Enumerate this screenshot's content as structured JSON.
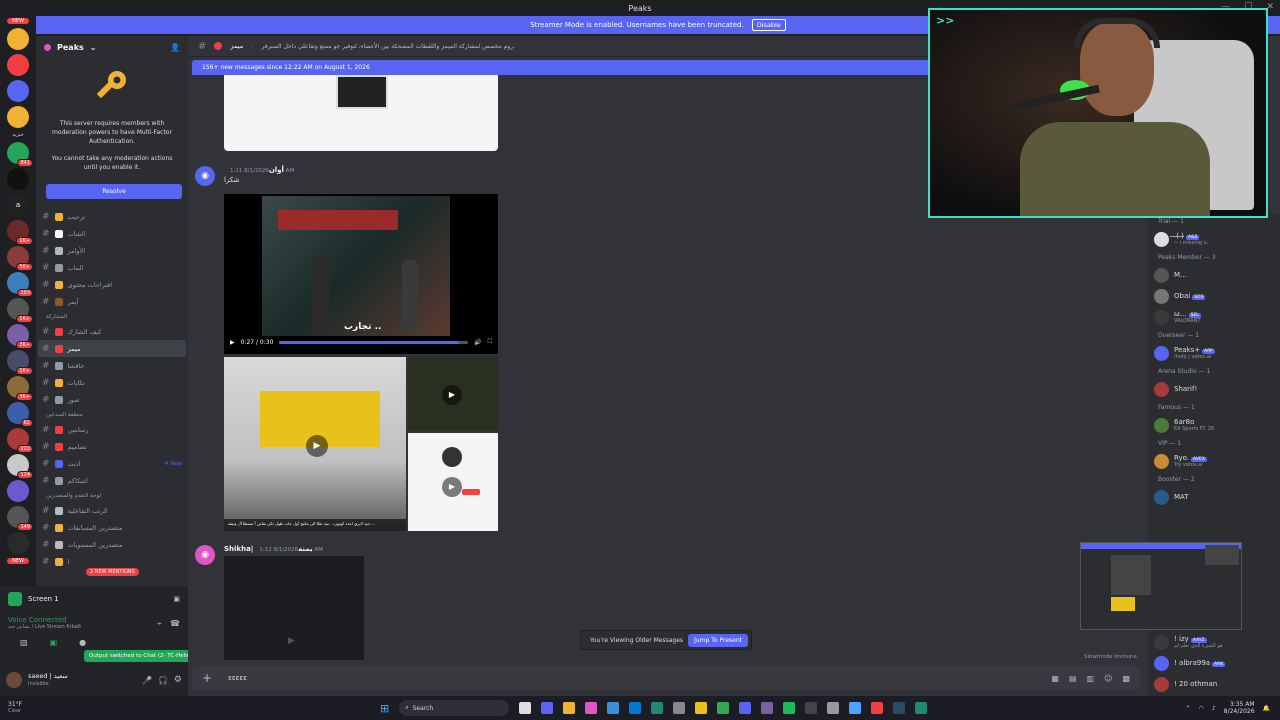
{
  "window": {
    "title": "Peaks"
  },
  "banner": {
    "text": "Streamer Mode is enabled. Usernames have been truncated.",
    "button": "Disable"
  },
  "servers": {
    "top_badge": "NEW",
    "bottom_badge": "NEW",
    "badges": [
      "841",
      "1K+",
      "5K+",
      "103",
      "1K+",
      "3K+",
      "1K+",
      "3K+",
      "62",
      "222",
      "124",
      "149"
    ],
    "labels": [
      "خنزيد",
      "a"
    ]
  },
  "sidebar": {
    "server_name": "Peaks",
    "mfa_notice": "This server requires members with moderation powers to have Multi-Factor Authentication.",
    "mfa_notice2": "You cannot take any moderation actions until you enable it.",
    "resolve": "Resolve",
    "channels_top": [
      {
        "name": "ترحيب",
        "color": "#f0b232"
      },
      {
        "name": "الشات",
        "color": "#ffffff"
      },
      {
        "name": "الأوامر",
        "color": "#b5bac1"
      },
      {
        "name": "الماب",
        "color": "#949ba4"
      },
      {
        "name": "اقتراحات محتوى",
        "color": "#f0b232"
      },
      {
        "name": "آيمر",
        "color": "#8b5a2b"
      }
    ],
    "cat1": "المشاركة",
    "channels_mid": [
      {
        "name": "كيف الشارك",
        "color": "#f23f43"
      },
      {
        "name": "ميمز",
        "color": "#f23f43"
      },
      {
        "name": "خاقشا",
        "color": "#949ba4"
      },
      {
        "name": "تكايات",
        "color": "#f0b232"
      },
      {
        "name": "صور",
        "color": "#949ba4"
      }
    ],
    "cat2": "منطقة المبدعين",
    "channels_creators": [
      {
        "name": "رسامين",
        "color": "#f23f43"
      },
      {
        "name": "تصاميم",
        "color": "#f23f43"
      },
      {
        "name": "ادبت",
        "color": "#5865f2",
        "new": "4 New"
      },
      {
        "name": "اشكاكم",
        "color": "#949ba4"
      }
    ],
    "cat3": "لوحة التقدم والمتصدرين",
    "channels_board": [
      {
        "name": "الرتب التفاعلية",
        "color": "#b5bac1"
      },
      {
        "name": "متصدرين المسابقات",
        "color": "#f0b232"
      },
      {
        "name": "متصدرين المستويات",
        "color": "#b5bac1"
      },
      {
        "name": "ا",
        "color": "#f0b232"
      }
    ],
    "mentions": "2 NEW MENTIONS"
  },
  "panel": {
    "screen": "Screen 1",
    "voice": "Voice Connected",
    "voice_sub": "بشاعر حنه / Live Stream 6rba6",
    "toast": "Output switched to Chat (2- TC-Helicon...",
    "user": "saeed | سعيد",
    "status": "Invisible"
  },
  "channel": {
    "name": "ميمز",
    "topic": "روم مخصص لمشاركة الميمز واللقطات المضحكة بين الأعضاء، لتوفير جو ممتع وتفاعلي داخل السيرفر."
  },
  "newbar": "156+ new messages since 12:22 AM on August 1, 2026",
  "messages": [
    {
      "author": "أوان",
      "time": "8/1/2026 1:11 AM",
      "text": "شكرا",
      "video_time": "0:27 / 0:30",
      "caption": "تجارب ..",
      "post_caption": "جيد لايري اعدد كوبون... ميد تقلا الى ماتيح أول جاب طول تكن تفاص آ مسطا آل وثيقة...."
    },
    {
      "author": "Shikha|يمنه",
      "time": "8/1/2026 1:12 AM"
    }
  ],
  "older": {
    "text": "You're Viewing Older Messages",
    "button": "Jump To Present"
  },
  "composer": {
    "value": "ɛɛɛɛɛ"
  },
  "slowmode": "Slowmode Immune",
  "members": {
    "groups": [
      {
        "title": "Trial — 1",
        "members": [
          {
            "name": "̶ ̶(̶ ̶)̶",
            "tag": "A&S",
            "sub": "~ i missing u."
          }
        ]
      },
      {
        "title": "Peaks Member — 3",
        "members": [
          {
            "name": "M...",
            "tag": "",
            "sub": ""
          },
          {
            "name": "Obai",
            "tag": "SOS",
            "sub": ""
          },
          {
            "name": "ω...",
            "tag": "SEL",
            "sub": "VALORANT"
          }
        ]
      },
      {
        "title": "Overseer — 1",
        "members": [
          {
            "name": "Peaks+",
            "tag": "APP",
            "sub": "/help | vetos.ai"
          }
        ]
      },
      {
        "title": "Arena Studio — 1",
        "members": [
          {
            "name": "Sharif!",
            "tag": "",
            "sub": ""
          }
        ]
      },
      {
        "title": "Famous — 1",
        "members": [
          {
            "name": "6ar8o",
            "tag": "",
            "sub": "EA Sports FC 26"
          }
        ]
      },
      {
        "title": "VIP — 1",
        "members": [
          {
            "name": "Ryo.",
            "tag": "AVEX",
            "sub": "Try vetos.ai"
          }
        ]
      },
      {
        "title": "Booster — 2",
        "members": [
          {
            "name": "MAT",
            "tag": "",
            "sub": ""
          }
        ]
      }
    ],
    "bottom": [
      {
        "name": "! izy",
        "tag": "AAYZ",
        "sub": "هو الشيء الذي تعلم لم"
      },
      {
        "name": "! albra99a",
        "tag": "ARK",
        "sub": ""
      },
      {
        "name": "! 20 othman",
        "tag": "",
        "sub": ""
      }
    ]
  },
  "taskbar": {
    "weather": "31°F",
    "weather_sub": "Clear",
    "search": "Search",
    "time": "3:35 AM",
    "date": "8/24/2026"
  },
  "colors": {
    "accent": "#5865f2",
    "cam_border": "#3ee0c6",
    "red": "#f23f43",
    "green": "#23a55a"
  }
}
